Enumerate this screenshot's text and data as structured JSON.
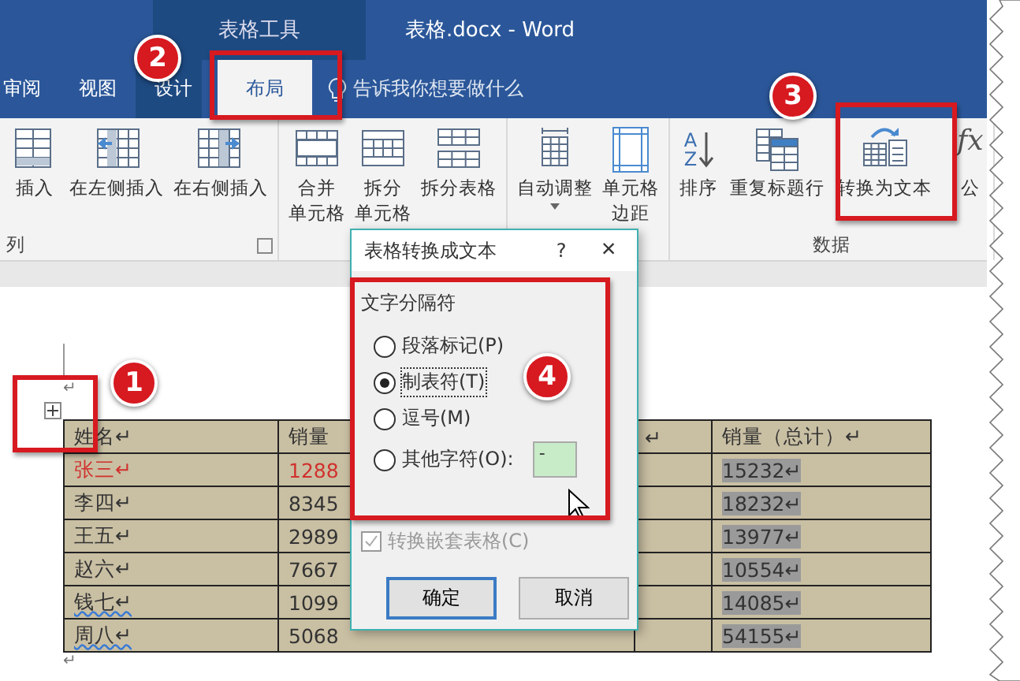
{
  "window": {
    "title": "表格.docx - Word",
    "context_tab": "表格工具"
  },
  "tabs": [
    {
      "label": "审阅",
      "selected": false,
      "contextual": false
    },
    {
      "label": "视图",
      "selected": false,
      "contextual": false
    },
    {
      "label": "设计",
      "selected": false,
      "contextual": true
    },
    {
      "label": "布局",
      "selected": true,
      "contextual": true
    }
  ],
  "tell_me": "告诉我你想要做什么",
  "ribbon": {
    "groups": [
      {
        "label": "列",
        "launcher": true,
        "items": [
          {
            "lines": [
              "插入"
            ],
            "kind": "insertbelow",
            "dropdown": false
          },
          {
            "lines": [
              "在左侧插入"
            ],
            "kind": "insertleft",
            "dropdown": false
          },
          {
            "lines": [
              "在右侧插入"
            ],
            "kind": "insertright",
            "dropdown": false
          }
        ]
      },
      {
        "items": [
          {
            "lines": [
              "合并",
              "单元格"
            ],
            "kind": "merge",
            "dropdown": false
          },
          {
            "lines": [
              "拆分",
              "单元格"
            ],
            "kind": "splitcells",
            "dropdown": false
          },
          {
            "lines": [
              "拆分表格"
            ],
            "kind": "splittable",
            "dropdown": false
          }
        ]
      },
      {
        "items": [
          {
            "lines": [
              "自动调整"
            ],
            "kind": "autofit",
            "dropdown": true
          },
          {
            "lines": [
              "单元格",
              "边距"
            ],
            "kind": "margins",
            "dropdown": false
          }
        ]
      },
      {
        "label": "数据",
        "items": [
          {
            "lines": [
              "排序"
            ],
            "kind": "sort",
            "icon_text": "AZ",
            "dropdown": false
          },
          {
            "lines": [
              "重复标题行"
            ],
            "kind": "repeatheader",
            "dropdown": false
          },
          {
            "lines": [
              "转换为文本"
            ],
            "kind": "convert",
            "dropdown": false
          },
          {
            "lines": [
              "公"
            ],
            "kind": "formula",
            "icon_text": "fx",
            "dropdown": false
          }
        ]
      }
    ]
  },
  "document": {
    "marks_before": "↵",
    "marks_after": "↵",
    "table": {
      "columns": [
        "姓名↵",
        "销量",
        "↵",
        "销量（总计）↵"
      ],
      "rows": [
        {
          "cells": [
            "张三↵",
            "1288",
            "",
            "15232↵"
          ],
          "color": "#d0312d",
          "spell_error": false,
          "selected": true
        },
        {
          "cells": [
            "李四↵",
            "8345",
            "",
            "18232↵"
          ],
          "color": "#333333",
          "spell_error": false,
          "selected": true
        },
        {
          "cells": [
            "王五↵",
            "2989",
            "",
            "13977↵"
          ],
          "color": "#333333",
          "spell_error": false,
          "selected": true
        },
        {
          "cells": [
            "赵六↵",
            "7667",
            "",
            "10554↵"
          ],
          "color": "#333333",
          "spell_error": false,
          "selected": true
        },
        {
          "cells": [
            "钱七↵",
            "1099",
            "",
            "14085↵"
          ],
          "color": "#333333",
          "spell_error": true,
          "selected": true
        },
        {
          "cells": [
            "周八↵",
            "5068",
            "",
            "54155↵"
          ],
          "color": "#333333",
          "spell_error": true,
          "selected": true
        }
      ]
    }
  },
  "dialog": {
    "title": "表格转换成文本",
    "help": "?",
    "close": "×",
    "group": "文字分隔符",
    "options": [
      {
        "label": "段落标记(P)",
        "selected": false
      },
      {
        "label": "制表符(T)",
        "selected": true
      },
      {
        "label": "逗号(M)",
        "selected": false
      },
      {
        "label": "其他字符(O):",
        "selected": false
      }
    ],
    "other_value": "-",
    "nested": {
      "label": "转换嵌套表格(C)",
      "checked": true,
      "disabled": true
    },
    "buttons": [
      "确定",
      "取消"
    ]
  },
  "callouts": [
    {
      "number": "1"
    },
    {
      "number": "2"
    },
    {
      "number": "3"
    },
    {
      "number": "4"
    }
  ]
}
